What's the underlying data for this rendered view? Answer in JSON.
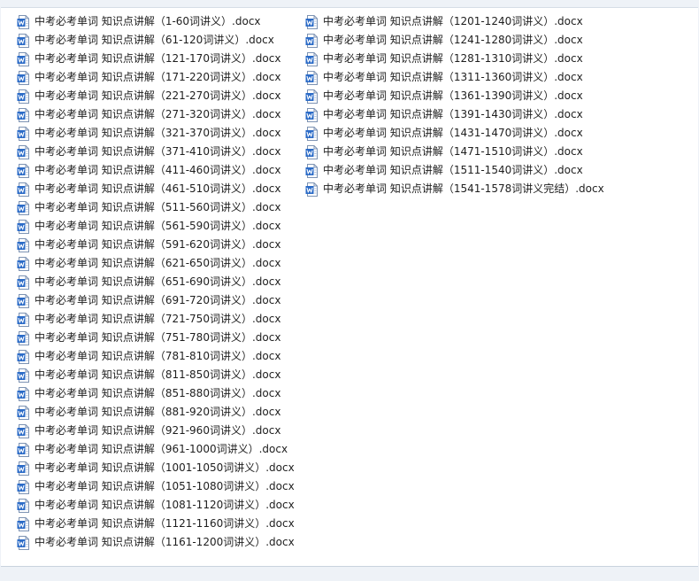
{
  "accent": "#2b6bc7",
  "icon": "word-document-icon",
  "columns": [
    {
      "files": [
        "中考必考单词 知识点讲解（1-60词讲义）.docx",
        "中考必考单词 知识点讲解（61-120词讲义）.docx",
        "中考必考单词 知识点讲解（121-170词讲义）.docx",
        "中考必考单词 知识点讲解（171-220词讲义）.docx",
        "中考必考单词 知识点讲解（221-270词讲义）.docx",
        "中考必考单词 知识点讲解（271-320词讲义）.docx",
        "中考必考单词 知识点讲解（321-370词讲义）.docx",
        "中考必考单词 知识点讲解（371-410词讲义）.docx",
        "中考必考单词 知识点讲解（411-460词讲义）.docx",
        "中考必考单词 知识点讲解（461-510词讲义）.docx",
        "中考必考单词 知识点讲解（511-560词讲义）.docx",
        "中考必考单词 知识点讲解（561-590词讲义）.docx",
        "中考必考单词 知识点讲解（591-620词讲义）.docx",
        "中考必考单词 知识点讲解（621-650词讲义）.docx",
        "中考必考单词 知识点讲解（651-690词讲义）.docx",
        "中考必考单词 知识点讲解（691-720词讲义）.docx",
        "中考必考单词 知识点讲解（721-750词讲义）.docx",
        "中考必考单词 知识点讲解（751-780词讲义）.docx",
        "中考必考单词 知识点讲解（781-810词讲义）.docx",
        "中考必考单词 知识点讲解（811-850词讲义）.docx",
        "中考必考单词 知识点讲解（851-880词讲义）.docx",
        "中考必考单词 知识点讲解（881-920词讲义）.docx",
        "中考必考单词 知识点讲解（921-960词讲义）.docx",
        "中考必考单词 知识点讲解（961-1000词讲义）.docx",
        "中考必考单词 知识点讲解（1001-1050词讲义）.docx",
        "中考必考单词 知识点讲解（1051-1080词讲义）.docx",
        "中考必考单词 知识点讲解（1081-1120词讲义）.docx",
        "中考必考单词 知识点讲解（1121-1160词讲义）.docx",
        "中考必考单词 知识点讲解（1161-1200词讲义）.docx"
      ]
    },
    {
      "files": [
        "中考必考单词 知识点讲解（1201-1240词讲义）.docx",
        "中考必考单词 知识点讲解（1241-1280词讲义）.docx",
        "中考必考单词 知识点讲解（1281-1310词讲义）.docx",
        "中考必考单词 知识点讲解（1311-1360词讲义）.docx",
        "中考必考单词 知识点讲解（1361-1390词讲义）.docx",
        "中考必考单词 知识点讲解（1391-1430词讲义）.docx",
        "中考必考单词 知识点讲解（1431-1470词讲义）.docx",
        "中考必考单词 知识点讲解（1471-1510词讲义）.docx",
        "中考必考单词 知识点讲解（1511-1540词讲义）.docx",
        "中考必考单词 知识点讲解（1541-1578词讲义完结）.docx"
      ]
    }
  ]
}
